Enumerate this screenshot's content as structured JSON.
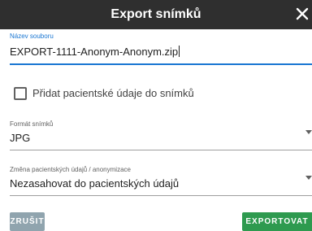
{
  "dialog": {
    "title": "Export snímků",
    "close_icon": "close-icon"
  },
  "filename": {
    "label": "Název souboru",
    "value": "EXPORT-1111-Anonym-Anonym.zip"
  },
  "checkbox": {
    "label": "Přidat pacientské údaje do snímků",
    "checked": false
  },
  "format": {
    "label": "Formát snímků",
    "value": "JPG",
    "icon": "dropdown-arrow-icon"
  },
  "anonymization": {
    "label": "Změna pacientských údajů / anonymizace",
    "value": "Nezasahovat do pacientských údajů",
    "icon": "dropdown-arrow-icon"
  },
  "buttons": {
    "cancel": "ZRUŠIT",
    "export": "EXPORTOVAT"
  },
  "colors": {
    "titlebar": "#2f2f2f",
    "accent": "#1976d2",
    "export_button": "#2e9a4f",
    "cancel_button": "#90a4ae"
  }
}
